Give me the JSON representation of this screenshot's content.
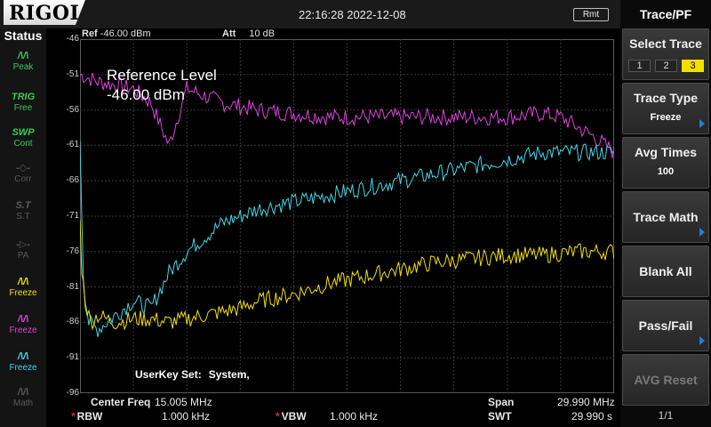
{
  "header": {
    "logo": "RIGOL",
    "datetime": "22:16:28 2022-12-08",
    "remote_badge": "Rmt"
  },
  "status": {
    "title": "Status",
    "items": [
      {
        "icon": "peak-icon",
        "glyph": "/\\/\\",
        "label": "Peak",
        "color": "#3cc85a"
      },
      {
        "icon": "trig-icon",
        "glyph": "TRIG",
        "label": "Free",
        "color": "#3cc85a"
      },
      {
        "icon": "sweep-icon",
        "glyph": "SWP",
        "label": "Cont",
        "color": "#3cc85a"
      },
      {
        "icon": "corr-icon",
        "glyph": "-◇-",
        "label": "Corr",
        "color": "#5a5a5a"
      },
      {
        "icon": "st-icon",
        "glyph": "S.T",
        "label": "S.T",
        "color": "#5a5a5a"
      },
      {
        "icon": "pa-icon",
        "glyph": "-▷-",
        "label": "PA",
        "color": "#5a5a5a"
      },
      {
        "icon": "trace1-icon",
        "glyph": "/\\/\\",
        "label": "Freeze",
        "color": "#f2e000"
      },
      {
        "icon": "trace2-icon",
        "glyph": "/\\/\\",
        "label": "Freeze",
        "color": "#e040e0"
      },
      {
        "icon": "trace3-icon",
        "glyph": "/\\/\\",
        "label": "Freeze",
        "color": "#40d8e8"
      },
      {
        "icon": "math-icon",
        "glyph": "/\\/\\",
        "label": "Math",
        "color": "#5a5a5a"
      }
    ]
  },
  "measure": {
    "ref_label": "Ref",
    "ref_value": "-46.00 dBm",
    "att_label": "Att",
    "att_value": "10 dB",
    "overlay_title": "Reference Level",
    "overlay_value": "-46.00 dBm",
    "userkey_label": "UserKey Set:",
    "userkey_value": "System,"
  },
  "y_axis": {
    "ticks": [
      "-46",
      "-51",
      "-56",
      "-61",
      "-66",
      "-71",
      "-76",
      "-81",
      "-86",
      "-91",
      "-96"
    ]
  },
  "bottom": {
    "center_freq_label": "Center Freq",
    "center_freq_value": "15.005 MHz",
    "span_label": "Span",
    "span_value": "29.990 MHz",
    "rbw_label": "RBW",
    "rbw_value": "1.000 kHz",
    "vbw_label": "VBW",
    "vbw_value": "1.000 kHz",
    "swt_label": "SWT",
    "swt_value": "29.990 s"
  },
  "menu": {
    "title": "Trace/PF",
    "select_trace_label": "Select Trace",
    "trace_options": [
      "1",
      "2",
      "3"
    ],
    "active_trace": "3",
    "trace_type_label": "Trace Type",
    "trace_type_value": "Freeze",
    "avg_times_label": "Avg Times",
    "avg_times_value": "100",
    "trace_math_label": "Trace Math",
    "blank_all_label": "Blank All",
    "pass_fail_label": "Pass/Fail",
    "avg_reset_label": "AVG Reset",
    "page": "1/1"
  },
  "chart_data": {
    "type": "line",
    "xlabel": "",
    "ylabel": "",
    "ylim": [
      -96,
      -46
    ],
    "xlim": [
      0.01,
      30.0
    ],
    "x_unit": "MHz",
    "y_unit": "dBm",
    "series": [
      {
        "color": "#e040e0",
        "x": [
          0.01,
          1,
          2,
          3,
          4,
          5,
          6,
          7,
          8,
          9,
          10,
          12,
          14,
          16,
          18,
          20,
          22,
          24,
          26,
          27,
          28,
          29,
          30
        ],
        "y": [
          -51,
          -52,
          -52.5,
          -53,
          -55,
          -61,
          -53,
          -54,
          -55,
          -55.5,
          -56,
          -56.5,
          -57,
          -57,
          -57,
          -57,
          -57,
          -57,
          -56.5,
          -57,
          -58.5,
          -60,
          -62
        ]
      },
      {
        "color": "#40d8e8",
        "x": [
          0.01,
          0.2,
          0.5,
          1,
          2,
          3,
          4,
          5,
          6,
          7,
          8,
          9,
          10,
          12,
          14,
          16,
          18,
          20,
          22,
          24,
          26,
          28,
          30
        ],
        "y": [
          -60,
          -80,
          -86,
          -87,
          -85,
          -83,
          -84,
          -79,
          -76,
          -74,
          -72,
          -71,
          -70,
          -69,
          -68,
          -67,
          -66,
          -65,
          -64,
          -63,
          -62,
          -62,
          -62
        ]
      },
      {
        "color": "#f2e000",
        "x": [
          0.01,
          0.1,
          0.3,
          0.6,
          1,
          2,
          3,
          4,
          5,
          6,
          7,
          8,
          9,
          10,
          12,
          14,
          16,
          18,
          20,
          22,
          24,
          26,
          28,
          30
        ],
        "y": [
          -72,
          -78,
          -83,
          -86,
          -85,
          -86,
          -85.5,
          -85.5,
          -86,
          -85.5,
          -85,
          -84.5,
          -84,
          -83,
          -82,
          -80.5,
          -79.5,
          -78.5,
          -77.5,
          -77,
          -76.5,
          -76.5,
          -76,
          -76
        ]
      }
    ]
  }
}
